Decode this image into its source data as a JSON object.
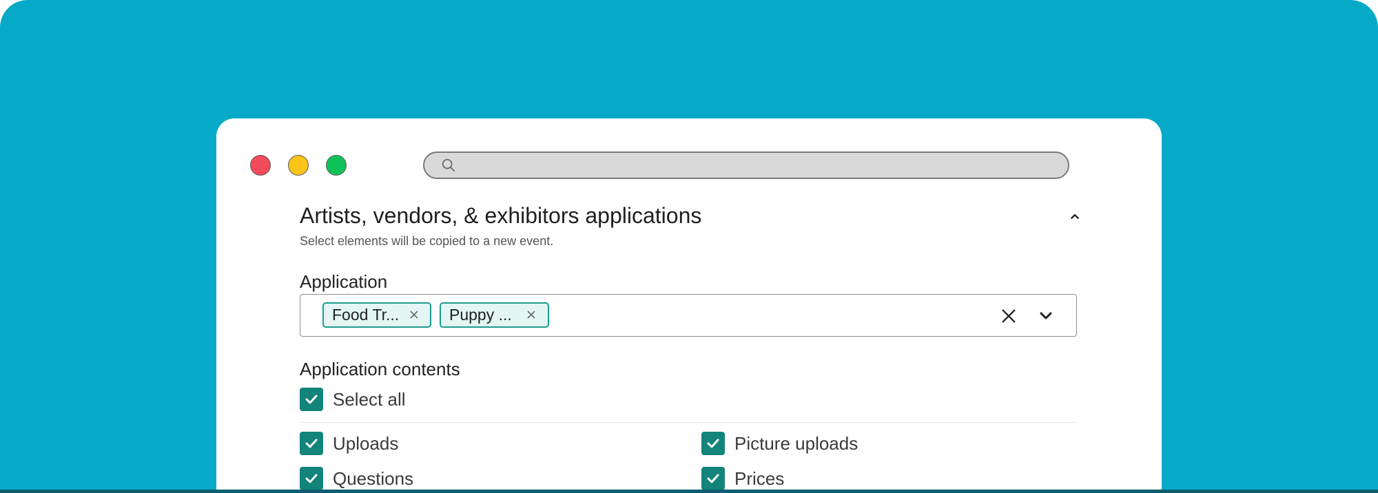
{
  "window": {
    "search_placeholder": ""
  },
  "section": {
    "title": "Artists, vendors, & exhibitors applications",
    "subtitle": "Select elements will be copied to a new event."
  },
  "application": {
    "label": "Application",
    "chips": [
      {
        "label": "Food Tr..."
      },
      {
        "label": "Puppy ..."
      }
    ]
  },
  "contents": {
    "label": "Application contents",
    "select_all": {
      "label": "Select all",
      "checked": true
    },
    "options": [
      {
        "label": "Uploads",
        "checked": true
      },
      {
        "label": "Picture uploads",
        "checked": true
      },
      {
        "label": "Questions",
        "checked": true
      },
      {
        "label": "Prices",
        "checked": true
      }
    ]
  },
  "colors": {
    "background": "#06aac8",
    "window": "#ffffff",
    "accent": "#12847a",
    "chip_border": "#1b9c8c",
    "chip_fill": "#e3f6f4",
    "traffic_red": "#f24b5a",
    "traffic_yellow": "#fcc419",
    "traffic_green": "#0fc257"
  },
  "icons": {
    "search": "search-icon",
    "collapse": "chevron-up-icon",
    "chip_remove": "close-icon",
    "clear": "close-icon",
    "dropdown": "chevron-down-icon",
    "check": "check-icon"
  }
}
